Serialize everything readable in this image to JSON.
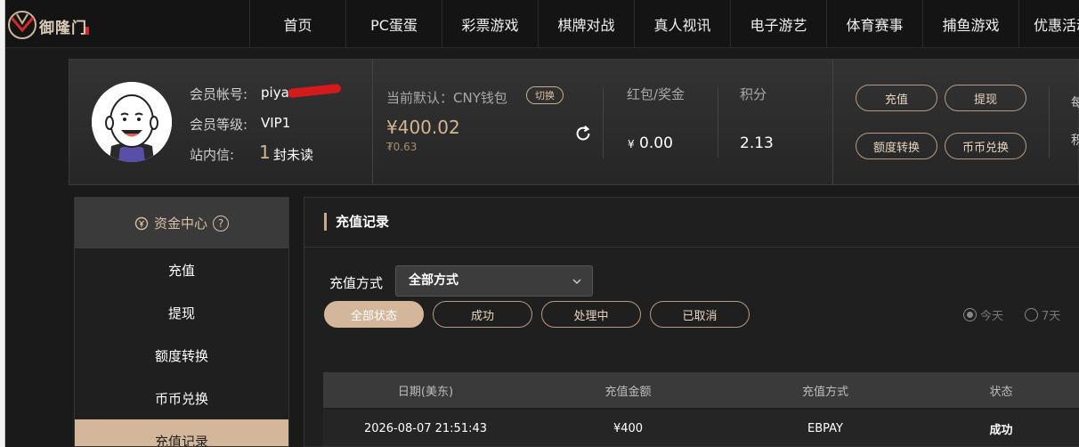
{
  "brand": {
    "logo_text": "御隆门"
  },
  "nav": [
    "首页",
    "PC蛋蛋",
    "彩票游戏",
    "棋牌对战",
    "真人视讯",
    "电子游艺",
    "体育赛事",
    "捕鱼游戏",
    "优惠活动"
  ],
  "member": {
    "account_label": "会员帐号:",
    "account_value": "piya",
    "level_label": "会员等级:",
    "level_value": "VIP1",
    "inbox_label": "站内信:",
    "inbox_count": "1",
    "inbox_suffix": "封未读"
  },
  "wallet": {
    "label": "当前默认：CNY钱包",
    "switch_label": "切换",
    "balance": "¥400.02",
    "balance_sub": "₮0.63"
  },
  "stats": {
    "bonus_label": "红包/奖金",
    "bonus_currency": "¥",
    "bonus_value": "0.00",
    "points_label": "积分",
    "points_value": "2.13"
  },
  "actions": {
    "deposit": "充值",
    "withdraw": "提现",
    "transfer": "额度转换",
    "coin_exchange": "币币兑换",
    "cut_1": "每",
    "cut_2": "积"
  },
  "sidebar": {
    "title": "资金中心",
    "help": "?",
    "items": [
      "充值",
      "提现",
      "额度转换",
      "币币兑换",
      "充值记录"
    ]
  },
  "main": {
    "title": "充值记录",
    "method_label": "充值方式",
    "method_value": "全部方式",
    "filters": [
      "全部状态",
      "成功",
      "处理中",
      "已取消"
    ],
    "range": [
      "今天",
      "7天"
    ],
    "columns": [
      "日期(美东)",
      "充值金额",
      "充值方式",
      "状态"
    ],
    "rows": [
      {
        "date": "2026-08-07 21:51:43",
        "amount": "¥400",
        "method": "EBPAY",
        "status": "成功"
      }
    ]
  },
  "colors": {
    "accent": "#d4b79a",
    "background": "#1a1a1a",
    "redaction": "#d41a1a"
  }
}
